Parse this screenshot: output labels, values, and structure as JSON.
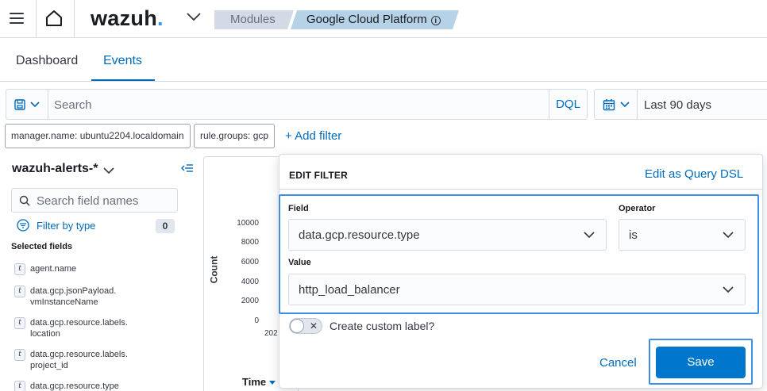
{
  "header": {
    "logo_text": "wazuh",
    "logo_dot": ".",
    "breadcrumbs": [
      "Modules",
      "Google Cloud Platform"
    ],
    "info_glyph": "i"
  },
  "tabs": [
    {
      "label": "Dashboard",
      "active": false
    },
    {
      "label": "Events",
      "active": true
    }
  ],
  "query": {
    "placeholder": "Search",
    "language": "DQL",
    "date_range": "Last 90 days"
  },
  "filters": {
    "pills": [
      "manager.name: ubuntu2204.localdomain",
      "rule.groups: gcp"
    ],
    "add_label": "+ Add filter"
  },
  "sidebar": {
    "index_pattern": "wazuh-alerts-*",
    "search_placeholder": "Search field names",
    "filter_by_type": "Filter by type",
    "filter_count": "0",
    "selected_heading": "Selected fields",
    "type_glyph": "t",
    "fields": [
      [
        "agent.name"
      ],
      [
        "data.gcp.jsonPayload.",
        "vmInstanceName"
      ],
      [
        "data.gcp.resource.labels.",
        "location"
      ],
      [
        "data.gcp.resource.labels.",
        "project_id"
      ],
      [
        "data.gcp.resource.type"
      ]
    ]
  },
  "chart": {
    "ylabel": "Count",
    "yticks": [
      "10000",
      "8000",
      "6000",
      "4000",
      "2000",
      "0"
    ],
    "xtick": "202",
    "time_column": "Time"
  },
  "edit_filter": {
    "title": "EDIT FILTER",
    "query_dsl_link": "Edit as Query DSL",
    "field_label": "Field",
    "field_value": "data.gcp.resource.type",
    "operator_label": "Operator",
    "operator_value": "is",
    "value_label": "Value",
    "value_value": "http_load_balancer",
    "custom_label": "Create custom label?",
    "custom_label_enabled": false,
    "cancel": "Cancel",
    "save": "Save"
  },
  "colors": {
    "link": "#006bb8",
    "primary_button": "#0077cc",
    "highlight_box": "#3f8fe8",
    "breadcrumb_active": "#b6d2e7",
    "breadcrumb_inactive": "#d3dae6"
  }
}
